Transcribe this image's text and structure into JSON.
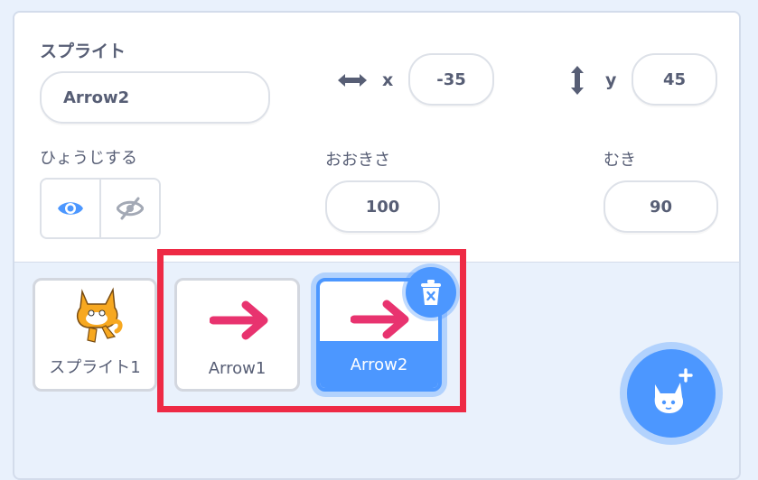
{
  "sprite_info": {
    "sprite_label": "スプライト",
    "sprite_name": "Arrow2",
    "x_label": "x",
    "x_value": "-35",
    "y_label": "y",
    "y_value": "45",
    "show_label": "ひょうじする",
    "size_label": "おおきさ",
    "size_value": "100",
    "direction_label": "むき",
    "direction_value": "90"
  },
  "sprites": [
    {
      "name": "スプライト1",
      "icon": "cat-sprite-icon",
      "selected": false
    },
    {
      "name": "Arrow1",
      "icon": "pink-arrow-icon",
      "selected": false
    },
    {
      "name": "Arrow2",
      "icon": "pink-arrow-icon",
      "selected": true
    }
  ],
  "colors": {
    "accent": "#4c97ff",
    "highlight_box": "#ee2a45",
    "arrow": "#e8336f",
    "text": "#575e75"
  }
}
